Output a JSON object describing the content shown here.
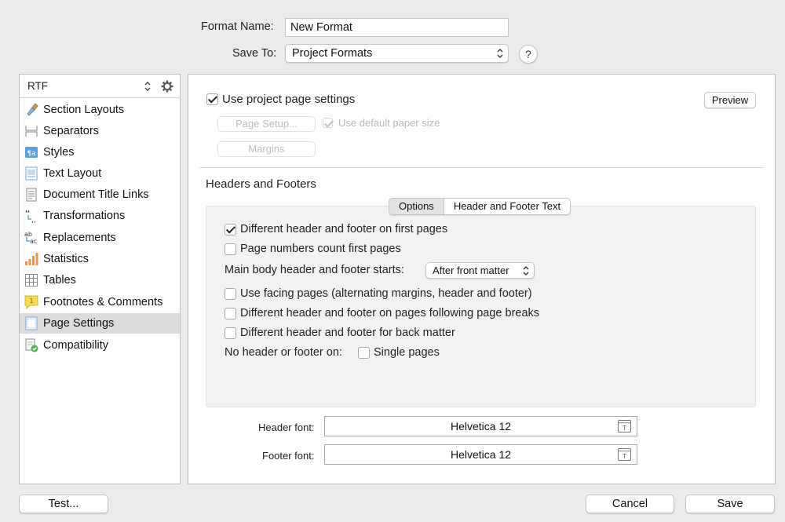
{
  "header": {
    "format_name_label": "Format Name:",
    "format_name_value": "New Format",
    "save_to_label": "Save To:",
    "save_to_value": "Project Formats",
    "help_label": "?"
  },
  "sidebar": {
    "file_type": "RTF",
    "items": [
      {
        "label": "Section Layouts",
        "icon": "brush-icon"
      },
      {
        "label": "Separators",
        "icon": "separator-icon"
      },
      {
        "label": "Styles",
        "icon": "styles-icon"
      },
      {
        "label": "Text Layout",
        "icon": "text-layout-icon"
      },
      {
        "label": "Document Title Links",
        "icon": "document-icon"
      },
      {
        "label": "Transformations",
        "icon": "transform-quotes-icon"
      },
      {
        "label": "Replacements",
        "icon": "replace-icon"
      },
      {
        "label": "Statistics",
        "icon": "bar-chart-icon"
      },
      {
        "label": "Tables",
        "icon": "table-icon"
      },
      {
        "label": "Footnotes & Comments",
        "icon": "comment-icon"
      },
      {
        "label": "Page Settings",
        "icon": "page-settings-icon",
        "selected": true
      },
      {
        "label": "Compatibility",
        "icon": "compatibility-icon"
      }
    ]
  },
  "main": {
    "use_project_label": "Use project page settings",
    "preview_label": "Preview",
    "page_setup_label": "Page Setup...",
    "use_default_paper_label": "Use default paper size",
    "margins_label": "Margins",
    "section_title": "Headers and Footers",
    "tabs": [
      {
        "label": "Options",
        "active": true
      },
      {
        "label": "Header and Footer Text",
        "active": false
      }
    ],
    "options": {
      "diff_first_pages": "Different header and footer on first pages",
      "page_numbers_count": "Page numbers count first pages",
      "main_body_label": "Main body header and footer starts:",
      "main_body_value": "After front matter",
      "facing_pages": "Use facing pages (alternating margins, header and footer)",
      "diff_following_breaks": "Different header and footer on pages following page breaks",
      "diff_back_matter": "Different header and footer for back matter",
      "no_header_label": "No header or footer on:",
      "single_pages": "Single pages"
    },
    "header_font_label": "Header font:",
    "header_font_value": "Helvetica 12",
    "footer_font_label": "Footer font:",
    "footer_font_value": "Helvetica 12"
  },
  "footer": {
    "test_label": "Test...",
    "cancel_label": "Cancel",
    "save_label": "Save"
  }
}
